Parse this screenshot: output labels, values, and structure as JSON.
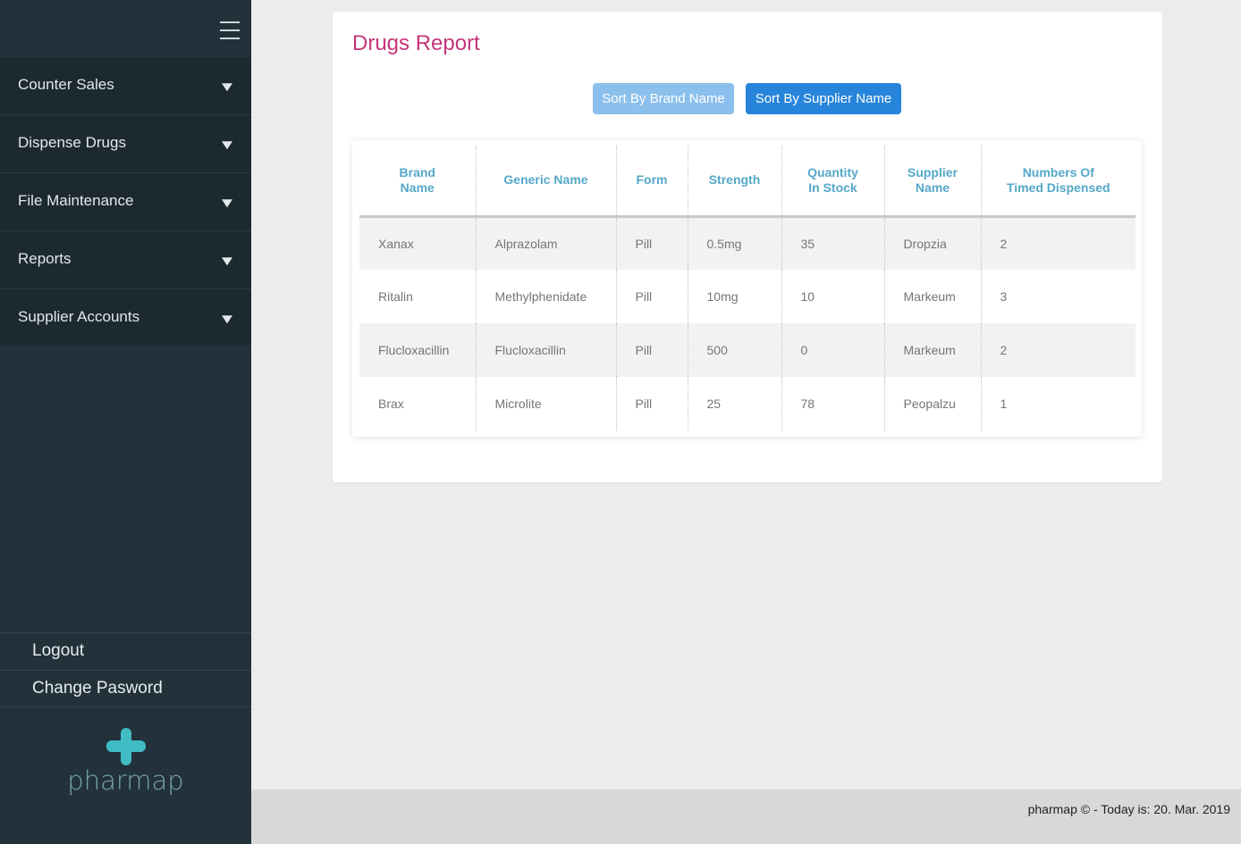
{
  "sidebar": {
    "menu": [
      {
        "label": "Counter Sales"
      },
      {
        "label": "Dispense Drugs"
      },
      {
        "label": "File Maintenance"
      },
      {
        "label": "Reports"
      },
      {
        "label": "Supplier Accounts"
      }
    ],
    "bottom_links": [
      {
        "label": "Logout"
      },
      {
        "label": "Change Pasword"
      }
    ],
    "logo_text": "pharmap"
  },
  "report": {
    "title": "Drugs Report",
    "sort_brand_label": "Sort By Brand Name",
    "sort_supplier_label": "Sort By Supplier Name",
    "columns": [
      [
        "Brand",
        "Name"
      ],
      [
        "Generic Name",
        ""
      ],
      [
        "Form",
        ""
      ],
      [
        "Strength",
        ""
      ],
      [
        "Quantity",
        "In Stock"
      ],
      [
        "Supplier",
        "Name"
      ],
      [
        "Numbers Of",
        "Timed Dispensed"
      ]
    ],
    "rows": [
      [
        "Xanax",
        "Alprazolam",
        "Pill",
        "0.5mg",
        "35",
        "Dropzia",
        "2"
      ],
      [
        "Ritalin",
        "Methylphenidate",
        "Pill",
        "10mg",
        "10",
        "Markeum",
        "3"
      ],
      [
        "Flucloxacillin",
        "Flucloxacillin",
        "Pill",
        "500",
        "0",
        "Markeum",
        "2"
      ],
      [
        "Brax",
        "Microlite",
        "Pill",
        "25",
        "78",
        "Peopalzu",
        "1"
      ]
    ]
  },
  "footer": {
    "text": "pharmap © - Today is: 20. Mar. 2019"
  },
  "colors": {
    "sidebar_bg": "#22313a",
    "title": "#c5357a",
    "header_text": "#55a8c9",
    "button_primary": "#2684da",
    "button_light": "#8cc0ec",
    "logo": "#3fbcc4"
  }
}
